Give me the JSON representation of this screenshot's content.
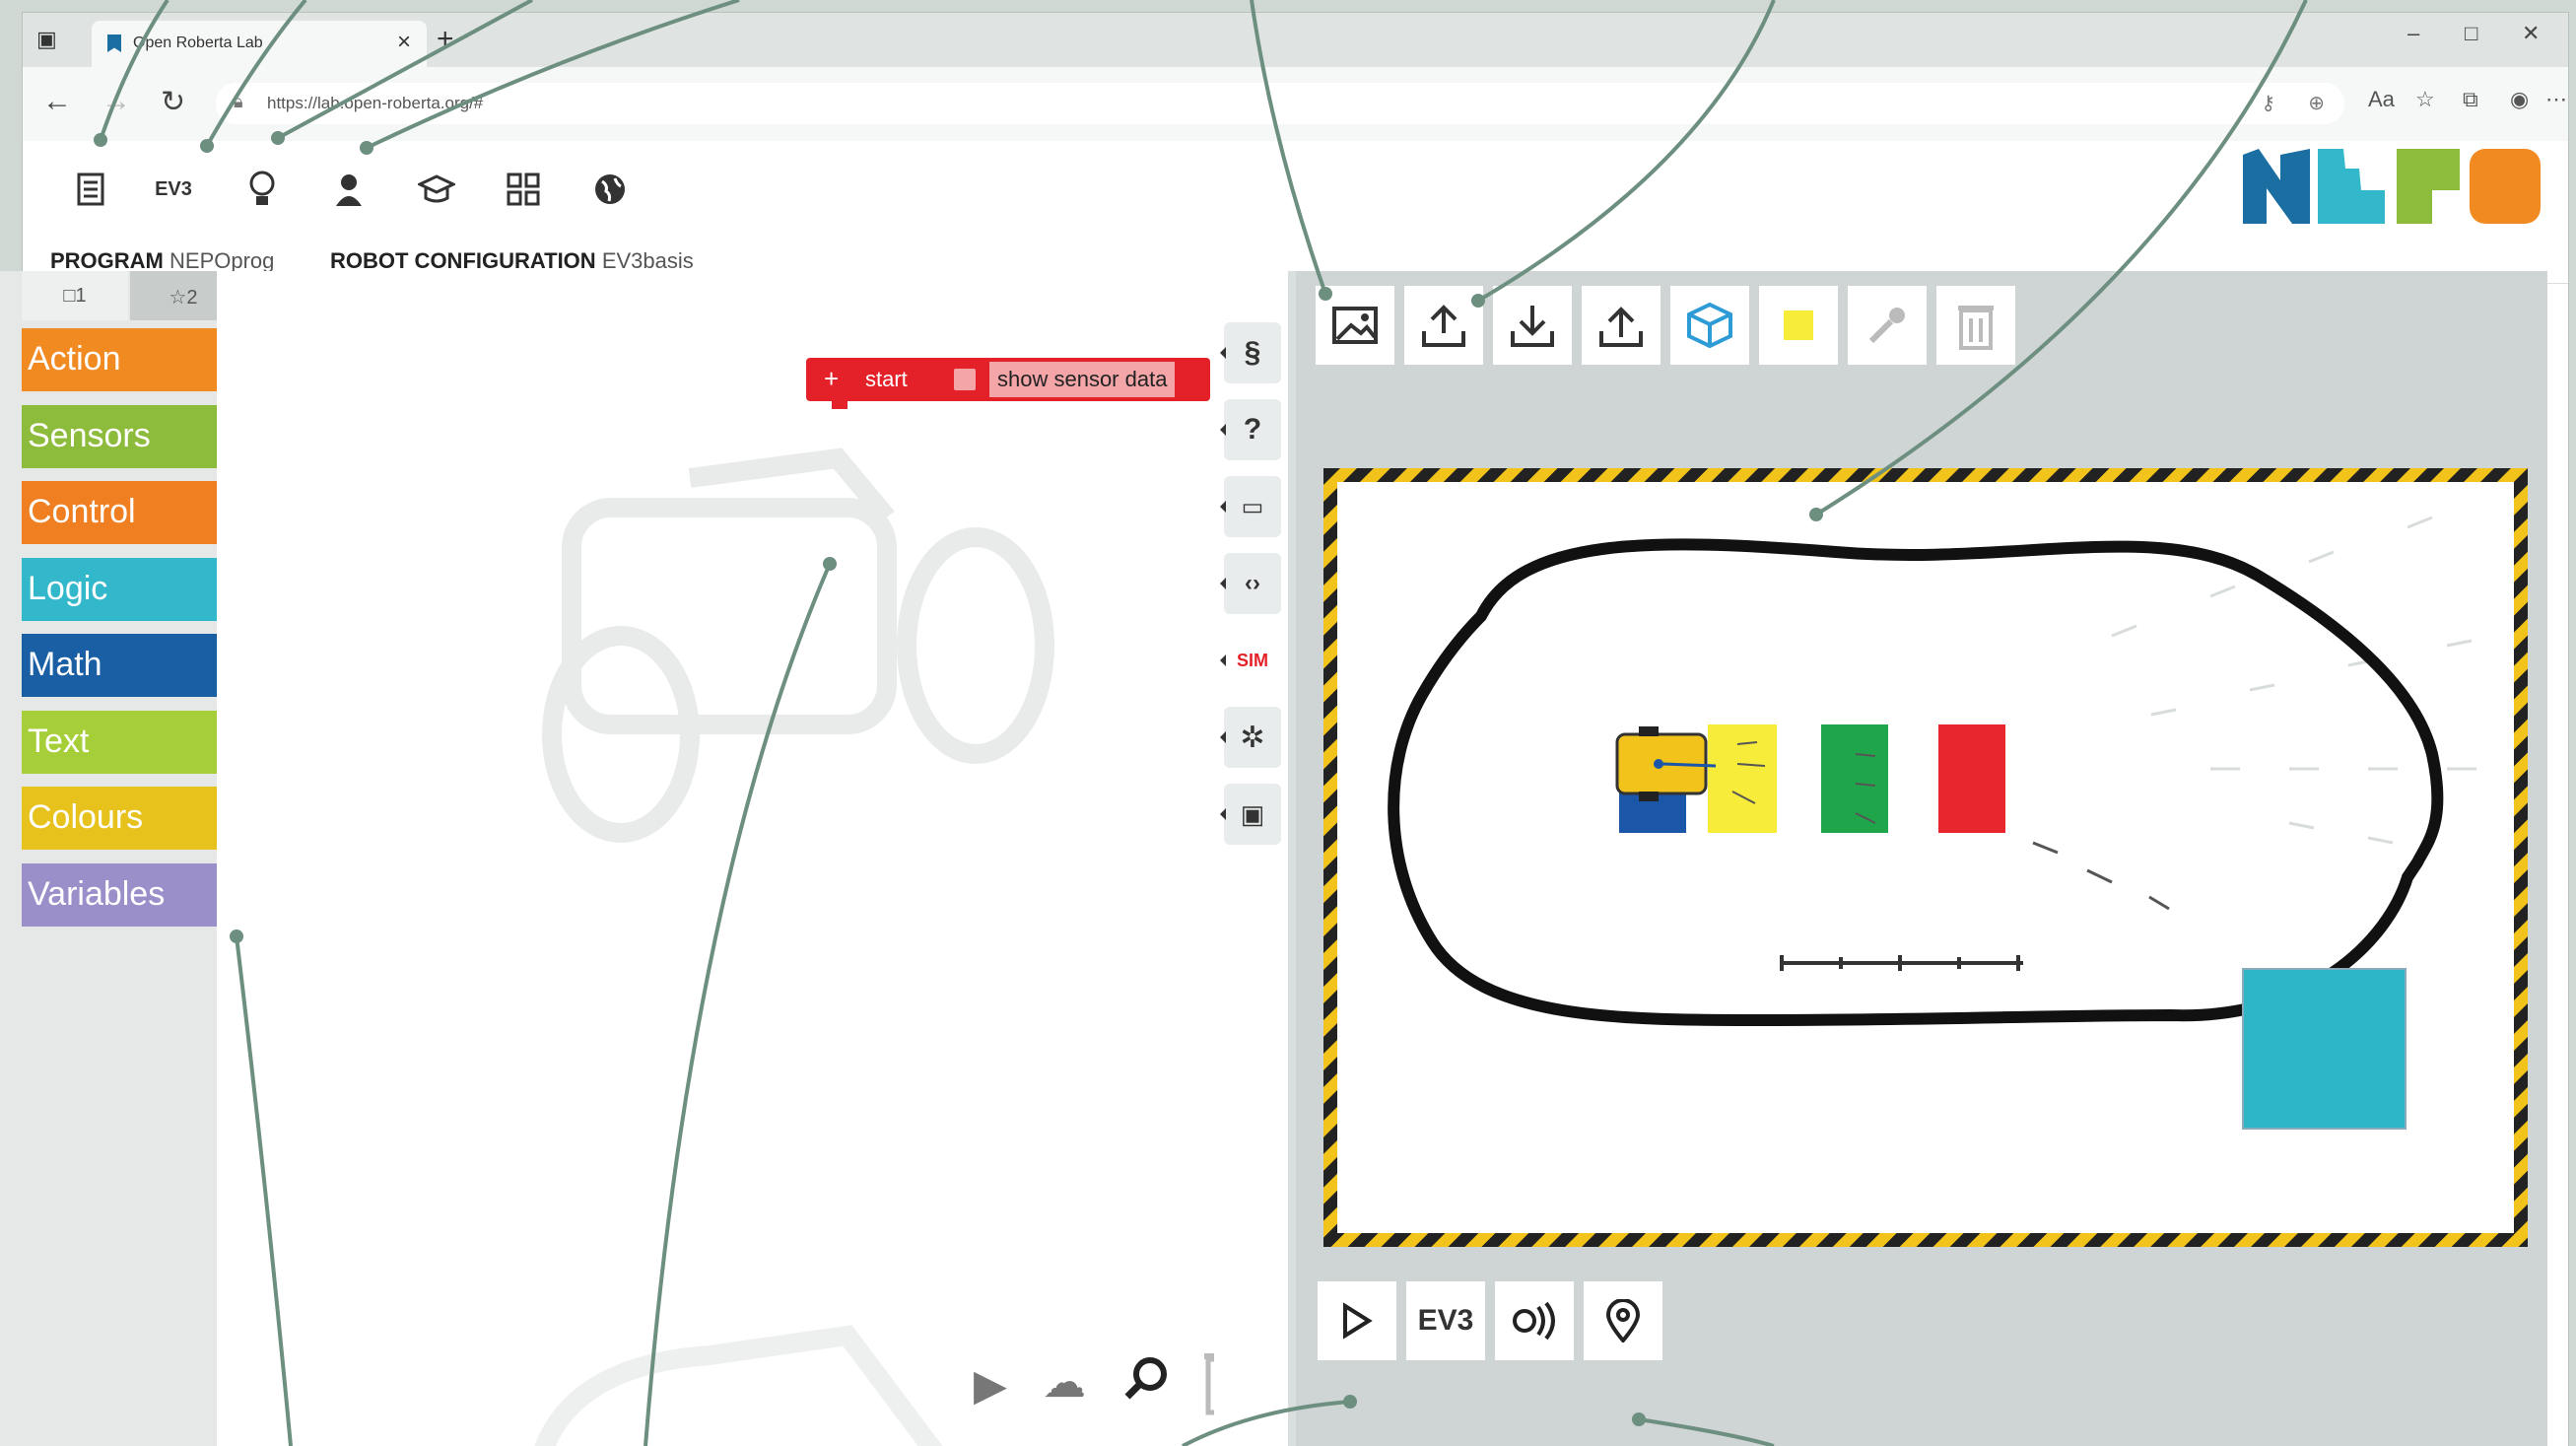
{
  "browser": {
    "tab_title": "Open Roberta Lab",
    "url": "https://lab.open-roberta.org/#",
    "tab_close": "×",
    "new_tab": "+",
    "window_controls": [
      "–",
      "□",
      "✕"
    ]
  },
  "header": {
    "icons": [
      "edit-icon",
      "ev3-icon",
      "lightbulb-icon",
      "user-icon",
      "graduation-cap-icon",
      "gallery-icon",
      "language-icon"
    ],
    "ev3_label": "EV3"
  },
  "tabs": {
    "program_label": "PROGRAM",
    "program_name": "NEPOprog",
    "config_label": "ROBOT CONFIGURATION",
    "config_name": "EV3basis"
  },
  "toolbox": {
    "level1": "□1",
    "level2": "☆2",
    "categories": [
      {
        "label": "Action",
        "color": "#f28a22"
      },
      {
        "label": "Sensors",
        "color": "#8dbb3b"
      },
      {
        "label": "Control",
        "color": "#f07f21"
      },
      {
        "label": "Logic",
        "color": "#33b8cb"
      },
      {
        "label": "Math",
        "color": "#1a5ea4"
      },
      {
        "label": "Text",
        "color": "#a6ce39"
      },
      {
        "label": "Colours",
        "color": "#e7c21c"
      },
      {
        "label": "Variables",
        "color": "#9b8fc9"
      }
    ]
  },
  "workspace": {
    "start_label": "start",
    "sensor_label": "show sensor data"
  },
  "side_toolbar": {
    "sim_label": "SIM",
    "buttons": [
      "code-section-icon",
      "help-icon",
      "comment-icon",
      "source-code-icon",
      "sim-tab",
      "settings-icon",
      "webcam-icon"
    ]
  },
  "sim_toolbar": [
    "image-icon",
    "upload-icon",
    "download-icon",
    "export-icon",
    "cube-icon",
    "color-square-icon",
    "eyedropper-icon",
    "trash-icon"
  ],
  "sim_bottom": {
    "ev3_label": "EV3"
  },
  "scene_colors": {
    "yellow": "#f7ec3a",
    "green": "#20a64a",
    "red": "#e8262d",
    "blue": "#1c56a8",
    "cyan": "#2db6c6",
    "hazard": "#f2c31b"
  }
}
